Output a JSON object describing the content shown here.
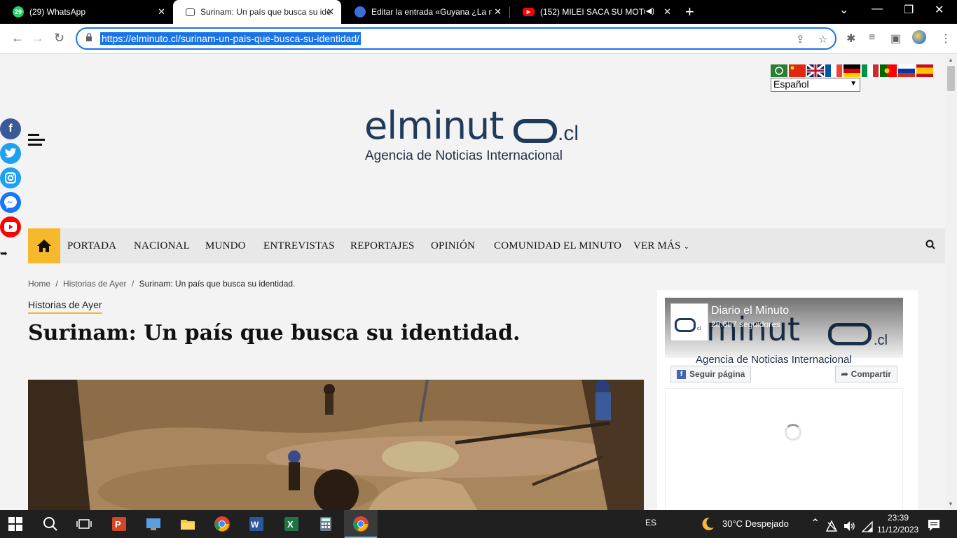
{
  "browser": {
    "tabs": [
      {
        "title": "(29) WhatsApp",
        "favicon_text": "29",
        "favicon_color": "#25d366",
        "active": false
      },
      {
        "title": "Surinam: Un país que busca su identidad.",
        "favicon_text": "",
        "favicon_color": "#ffffff",
        "active": true
      },
      {
        "title": "Editar la entrada «Guyana ¿La nueva",
        "favicon_text": "",
        "favicon_color": "#3b6fd8",
        "active": false
      },
      {
        "title": "(152) MILEI SACA SU MOTOSIERRA",
        "favicon_text": "▶",
        "favicon_color": "#ff0000",
        "active": false
      }
    ],
    "new_tab": "+",
    "url": "https://elminuto.cl/surinam-un-pais-que-busca-su-identidad/",
    "window_controls": [
      "⌄",
      "—",
      "❐",
      "✕"
    ]
  },
  "page": {
    "language": {
      "selected": "Español",
      "flags": [
        "ar",
        "zh",
        "en",
        "fr",
        "de",
        "it",
        "pt",
        "ru",
        "es"
      ]
    },
    "social": [
      {
        "name": "facebook",
        "glyph": "f",
        "color": "#3b5998"
      },
      {
        "name": "twitter",
        "glyph": "t",
        "color": "#1da1f2"
      },
      {
        "name": "instagram",
        "glyph": "◎",
        "color": "#1da1f2"
      },
      {
        "name": "messenger",
        "glyph": "✉",
        "color": "#1877f2"
      },
      {
        "name": "youtube",
        "glyph": "▶",
        "color": "#ff0000"
      }
    ],
    "logo": {
      "word": "elminut",
      "suffix": ".cl",
      "tagline": "Agencia de Noticias Internacional"
    },
    "nav": {
      "items": [
        "PORTADA",
        "NACIONAL",
        "MUNDO",
        "ENTREVISTAS",
        "REPORTAJES",
        "OPINIÓN",
        "COMUNIDAD EL MINUTO",
        "VER MÁS"
      ],
      "accent": "#f6b92b"
    },
    "breadcrumb": [
      "Home",
      "/",
      "Historias de Ayer",
      "/",
      "Surinam: Un país que busca su identidad."
    ],
    "category": "Historias de Ayer",
    "headline": "Surinam: Un país que busca su identidad.",
    "sidebar": {
      "page_name": "Diario el Minuto",
      "followers": "28.687 seguidores",
      "follow_label": "Seguir página",
      "share_label": "Compartir"
    }
  },
  "taskbar": {
    "ime": "ES",
    "weather": "30°C  Despejado",
    "time": "23:39",
    "date": "11/12/2023"
  }
}
